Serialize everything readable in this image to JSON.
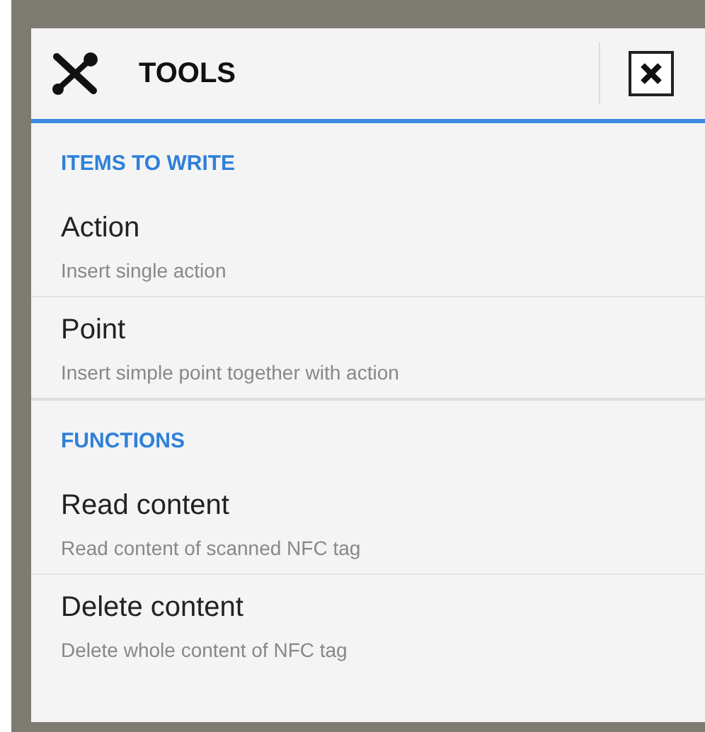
{
  "dialog": {
    "title": "TOOLS",
    "sections": [
      {
        "heading": "ITEMS TO WRITE",
        "items": [
          {
            "label": "Action",
            "description": "Insert single action"
          },
          {
            "label": "Point",
            "description": "Insert simple point together with action"
          }
        ]
      },
      {
        "heading": "FUNCTIONS",
        "items": [
          {
            "label": "Read content",
            "description": "Read content of scanned NFC tag"
          },
          {
            "label": "Delete content",
            "description": "Delete whole content of NFC tag"
          }
        ]
      }
    ]
  }
}
